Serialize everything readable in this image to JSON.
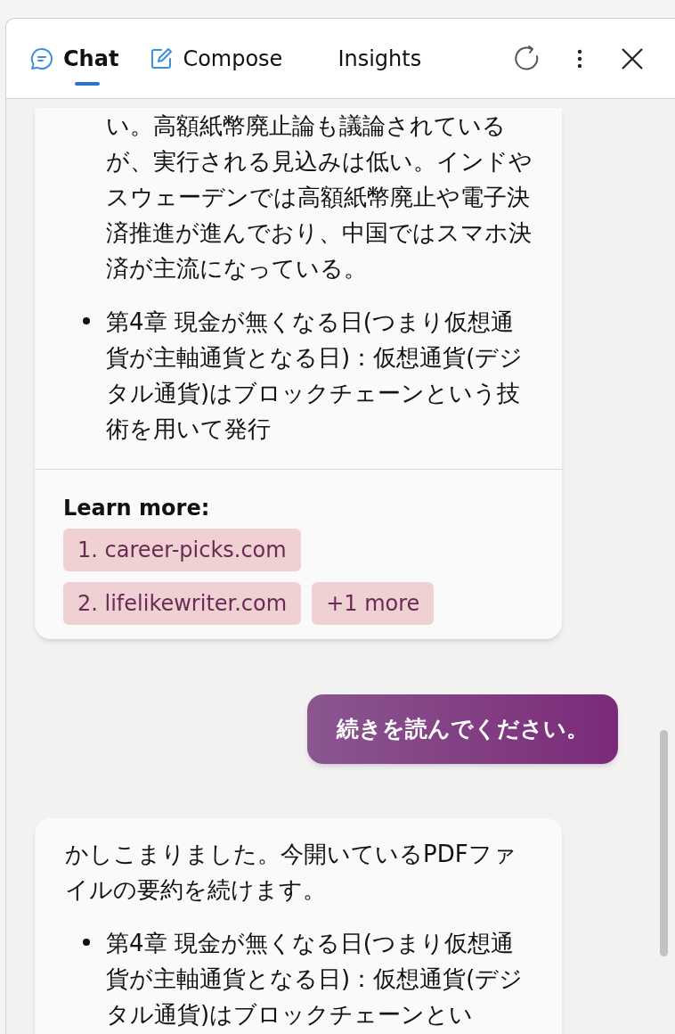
{
  "tabs": [
    {
      "label": "Chat",
      "kind": "chat",
      "selected": true
    },
    {
      "label": "Compose",
      "kind": "compose",
      "selected": false
    },
    {
      "label": "Insights",
      "kind": "plain",
      "selected": false
    }
  ],
  "messages": [
    {
      "kind": "assistant",
      "blocks": [
        {
          "kind": "continued",
          "text": "い。高額紙幣廃止論も議論されているが、実行される見込みは低い。インドやスウェーデンでは高額紙幣廃止や電子決済推進が進んでおり、中国ではスマホ決済が主流になっている。"
        },
        {
          "kind": "bullet",
          "text": "第4章 現金が無くなる日(つまり仮想通貨が主軸通貨となる日)：仮想通貨(デジタル通貨)はブロックチェーンという技術を用いて発行"
        }
      ],
      "learn_more": {
        "label": "Learn more:",
        "links": [
          "1. career-picks.com",
          "2. lifelikewriter.com",
          "+1 more"
        ]
      }
    },
    {
      "kind": "user",
      "text": "続きを読んでください。"
    },
    {
      "kind": "assistant",
      "blocks": [
        {
          "kind": "paragraph",
          "text": "かしこまりました。今開いているPDFファイルの要約を続けます。"
        },
        {
          "kind": "bullet",
          "text": "第4章 現金が無くなる日(つまり仮想通貨が主軸通貨となる日)：仮想通貨(デジタル通貨)はブロックチェーンとい"
        }
      ]
    }
  ]
}
